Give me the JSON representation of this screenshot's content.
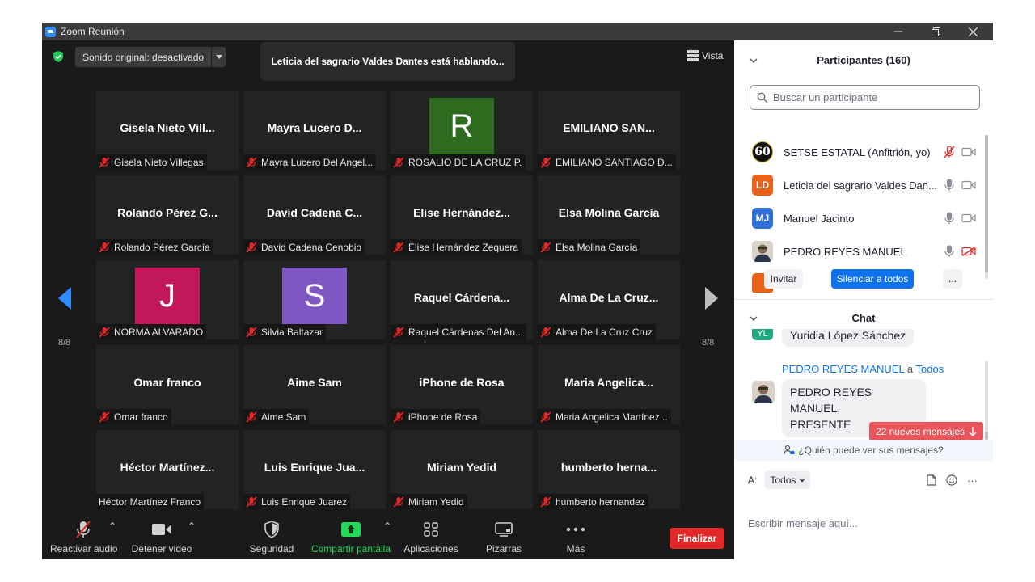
{
  "window": {
    "title": "Zoom Reunión"
  },
  "topbar": {
    "sound_label": "Sonido original: desactivado",
    "speaking_text": "Leticia del sagrario Valdes Dantes está hablando...",
    "view_label": "Vista"
  },
  "pagination": {
    "left": "8/8",
    "right": "8/8"
  },
  "tiles": [
    {
      "display": "Gisela Nieto Vill...",
      "label": "Gisela Nieto Villegas",
      "muted": true
    },
    {
      "display": "Mayra Lucero D...",
      "label": "Mayra Lucero Del Angel...",
      "muted": true
    },
    {
      "avatar": "R",
      "avatar_color": "#2f6b1f",
      "label": "ROSALIO DE LA CRUZ P.",
      "muted": true
    },
    {
      "display": "EMILIANO SAN...",
      "label": "EMILIANO SANTIAGO D...",
      "muted": true
    },
    {
      "display": "Rolando Pérez G...",
      "label": "Rolando Pérez García",
      "muted": true
    },
    {
      "display": "David Cadena C...",
      "label": "David Cadena Cenobio",
      "muted": true
    },
    {
      "display": "Elise Hernández...",
      "label": "Elise Hernández Zequera",
      "muted": true
    },
    {
      "display": "Elsa Molina García",
      "label": "Elsa Molina García",
      "muted": true
    },
    {
      "avatar": "J",
      "avatar_color": "#c2185b",
      "label": "NORMA ALVARADO",
      "muted": true
    },
    {
      "avatar": "S",
      "avatar_color": "#7e57c2",
      "label": "Silvia Baltazar",
      "muted": true
    },
    {
      "display": "Raquel Cárdena...",
      "label": "Raquel Cárdenas Del An...",
      "muted": true
    },
    {
      "display": "Alma De La Cruz...",
      "label": "Alma De La Cruz Cruz",
      "muted": true
    },
    {
      "display": "Omar franco",
      "label": "Omar franco",
      "muted": true
    },
    {
      "display": "Aime Sam",
      "label": "Aime Sam",
      "muted": true
    },
    {
      "display": "iPhone de Rosa",
      "label": "iPhone de Rosa",
      "muted": true
    },
    {
      "display": "Maria Angelica...",
      "label": "Maria Angelica Martínez...",
      "muted": true
    },
    {
      "display": "Héctor Martínez...",
      "label": "Héctor Martínez Franco",
      "muted": false
    },
    {
      "display": "Luis Enrique Jua...",
      "label": "Luis Enrique Juarez",
      "muted": true
    },
    {
      "display": "Miriam Yedid",
      "label": "Miriam Yedid",
      "muted": true
    },
    {
      "display": "humberto herna...",
      "label": "humberto hernandez",
      "muted": true
    }
  ],
  "toolbar": {
    "audio": "Reactivar audio",
    "video": "Detener video",
    "security": "Seguridad",
    "share": "Compartir pantalla",
    "apps": "Aplicaciones",
    "whiteboards": "Pizarras",
    "more": "Más",
    "end": "Finalizar"
  },
  "participants": {
    "title": "Participantes (160)",
    "search_placeholder": "Buscar un participante",
    "list": [
      {
        "name": "SETSE ESTATAL (Anfitrión, yo)",
        "avatar": "60",
        "avatar_color": "#111111"
      },
      {
        "name": "Leticia del sagrario Valdes Dan...",
        "avatar": "LD",
        "avatar_color": "#e8621a"
      },
      {
        "name": "Manuel Jacinto",
        "avatar": "MJ",
        "avatar_color": "#2f6fd6"
      },
      {
        "name": "PEDRO REYES MANUEL",
        "avatar": "",
        "avatar_color": "#b8a89a"
      }
    ],
    "invite": "Invitar",
    "mute_all": "Silenciar a todos",
    "more": "..."
  },
  "chat": {
    "title": "Chat",
    "partial_message": "Yuridia López Sánchez",
    "sender": "PEDRO REYES MANUEL",
    "to_word": "a",
    "recipient": "Todos",
    "message_line1": "PEDRO REYES MANUEL,",
    "message_line2": "PRESENTE",
    "new_messages": "22 nuevos mensajes",
    "who_can_see": "¿Quién puede ver sus mensajes?",
    "to_label": "A:",
    "to_value": "Todos",
    "input_placeholder": "Escribir mensaje aquí...",
    "more": "···"
  },
  "colors": {
    "accent": "#2d8cff",
    "share_green": "#23d959",
    "end_red": "#e02828",
    "muted_red": "#e02828"
  }
}
